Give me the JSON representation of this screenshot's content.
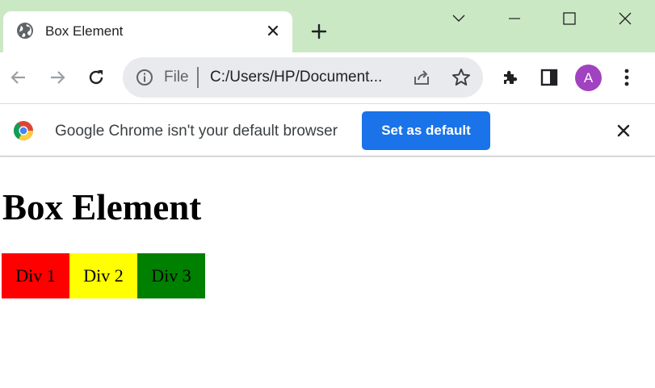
{
  "browser": {
    "tab": {
      "title": "Box Element"
    },
    "omnibox": {
      "scheme_label": "File",
      "url": "C:/Users/HP/Document..."
    },
    "avatar_letter": "A",
    "infobar": {
      "message": "Google Chrome isn't your default browser",
      "button_label": "Set as default"
    },
    "colors": {
      "frame": "#cbe8c4",
      "accent_button": "#1a73e8",
      "avatar": "#a142c0"
    }
  },
  "page": {
    "heading": "Box Element",
    "boxes": [
      {
        "label": "Div 1",
        "color": "#ff0000"
      },
      {
        "label": "Div 2",
        "color": "#ffff00"
      },
      {
        "label": "Div 3",
        "color": "#008000"
      }
    ]
  }
}
